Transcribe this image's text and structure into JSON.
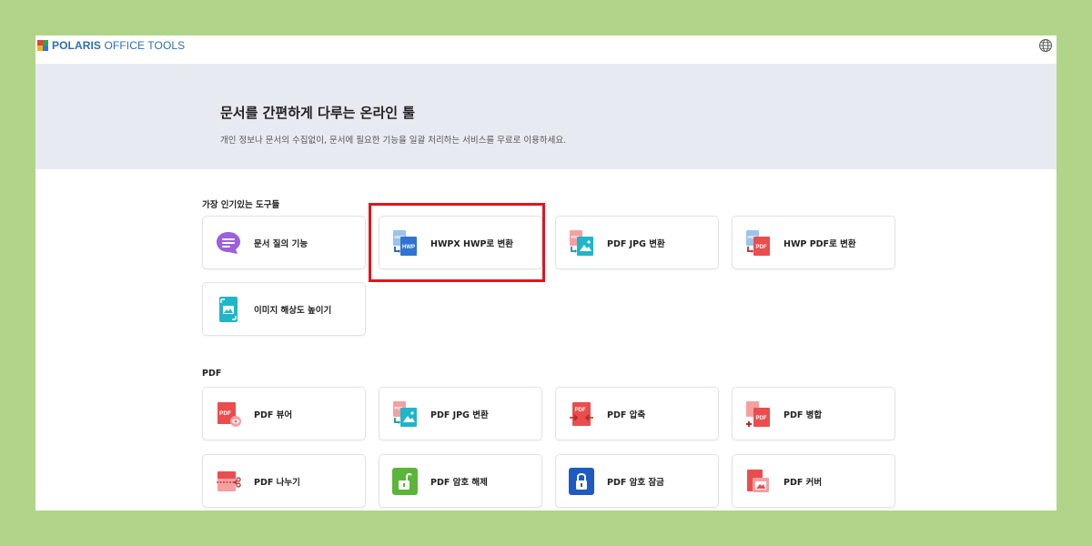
{
  "app": {
    "logo_bold": "POLARIS",
    "logo_rest": " OFFICE TOOLS",
    "language_icon": "globe-icon"
  },
  "hero": {
    "title": "문서를 간편하게 다루는 온라인 툴",
    "subtitle": "개인 정보나 문서의 수집없이, 문서에 필요한 기능을 일괄 처리하는 서비스를 무료로 이용하세요."
  },
  "popular": {
    "label": "가장 인기있는 도구들",
    "items": [
      {
        "label": "문서 질의 기능",
        "icon": "chat-icon"
      },
      {
        "label": "HWPX HWP로 변환",
        "icon": "hwpx-to-hwp-icon"
      },
      {
        "label": "PDF JPG 변환",
        "icon": "pdf-to-jpg-icon"
      },
      {
        "label": "HWP PDF로 변환",
        "icon": "hwp-to-pdf-icon"
      },
      {
        "label": "이미지 해상도 높이기",
        "icon": "image-upscale-icon"
      }
    ]
  },
  "pdf": {
    "label": "PDF",
    "items": [
      {
        "label": "PDF 뷰어",
        "icon": "pdf-viewer-icon"
      },
      {
        "label": "PDF JPG 변환",
        "icon": "pdf-to-jpg-icon"
      },
      {
        "label": "PDF 압축",
        "icon": "pdf-compress-icon"
      },
      {
        "label": "PDF 병합",
        "icon": "pdf-merge-icon"
      },
      {
        "label": "PDF 나누기",
        "icon": "pdf-split-icon"
      },
      {
        "label": "PDF 암호 해제",
        "icon": "unlock-icon"
      },
      {
        "label": "PDF 암호 잠금",
        "icon": "lock-icon"
      },
      {
        "label": "PDF 커버",
        "icon": "pdf-cover-icon"
      }
    ]
  },
  "colors": {
    "page_bg": "#b1d489",
    "hero_bg": "#e7ebf1",
    "highlight": "#e5141b",
    "brand": "#2d6fb0"
  }
}
